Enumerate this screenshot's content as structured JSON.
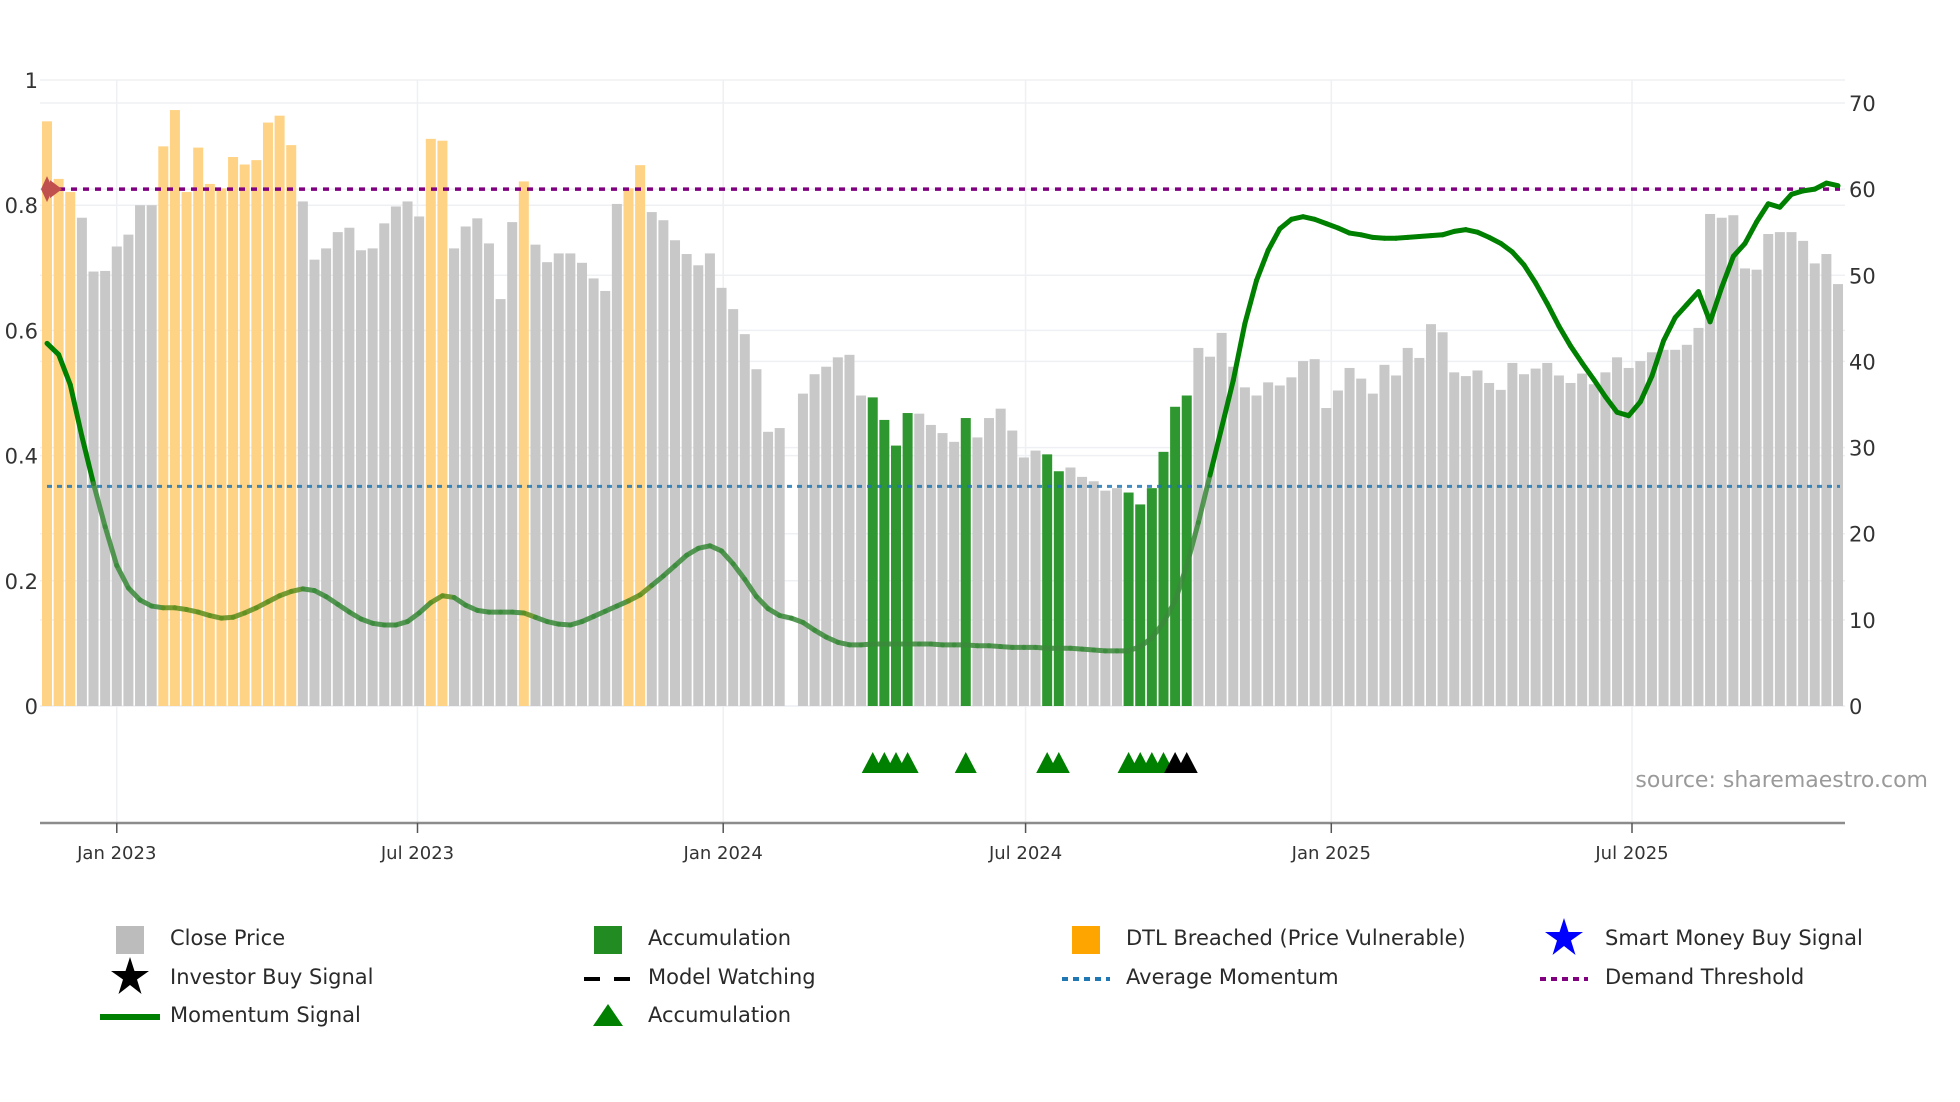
{
  "chart_data": {
    "type": "bar",
    "start_date": "2022-11-20",
    "interval_days": 7,
    "left_axis": {
      "range": [
        0,
        1
      ],
      "ticks": [
        0,
        0.2,
        0.4,
        0.6,
        0.8,
        1
      ],
      "tick_labels": [
        "0",
        "0.2",
        "0.4",
        "0.6",
        "0.8",
        "1"
      ]
    },
    "right_axis": {
      "range": [
        0,
        70
      ],
      "ticks": [
        0,
        10,
        20,
        30,
        40,
        50,
        60,
        70
      ],
      "tick_labels": [
        "0",
        "10",
        "20",
        "30",
        "40",
        "50",
        "60",
        "70"
      ]
    },
    "x_ticks": [
      {
        "date": "2023-01-01",
        "label": "Jan 2023"
      },
      {
        "date": "2023-07-01",
        "label": "Jul 2023"
      },
      {
        "date": "2024-01-01",
        "label": "Jan 2024"
      },
      {
        "date": "2024-07-01",
        "label": "Jul 2024"
      },
      {
        "date": "2025-01-01",
        "label": "Jan 2025"
      },
      {
        "date": "2025-07-01",
        "label": "Jul 2025"
      }
    ],
    "close_price": [
      0.934,
      0.842,
      0.821,
      0.78,
      0.694,
      0.695,
      0.734,
      0.753,
      0.8,
      0.8,
      0.894,
      0.952,
      0.821,
      0.892,
      0.834,
      0.827,
      0.877,
      0.865,
      0.872,
      0.932,
      0.943,
      0.896,
      0.806,
      0.713,
      0.731,
      0.757,
      0.764,
      0.728,
      0.731,
      0.771,
      0.798,
      0.806,
      0.782,
      0.906,
      0.903,
      0.731,
      0.766,
      0.779,
      0.739,
      0.65,
      0.773,
      0.838,
      0.737,
      0.709,
      0.723,
      0.723,
      0.708,
      0.683,
      0.663,
      0.802,
      0.827,
      0.864,
      0.789,
      0.776,
      0.744,
      0.722,
      0.704,
      0.723,
      0.668,
      0.634,
      0.594,
      0.538,
      0.438,
      0.444,
      0,
      0.499,
      0.53,
      0.542,
      0.557,
      0.561,
      0.496,
      0.493,
      0.457,
      0.416,
      0.468,
      0.467,
      0.449,
      0.436,
      0.422,
      0.46,
      0.429,
      0.46,
      0.475,
      0.44,
      0.397,
      0.408,
      0.402,
      0.375,
      0.381,
      0.366,
      0.359,
      0.344,
      0.348,
      0.341,
      0.322,
      0.348,
      0.406,
      0.478,
      0.496,
      0.572,
      0.558,
      0.596,
      0.542,
      0.509,
      0.496,
      0.517,
      0.512,
      0.525,
      0.551,
      0.554,
      0.476,
      0.504,
      0.54,
      0.523,
      0.499,
      0.545,
      0.528,
      0.572,
      0.556,
      0.61,
      0.597,
      0.533,
      0.527,
      0.536,
      0.516,
      0.505,
      0.548,
      0.53,
      0.539,
      0.548,
      0.528,
      0.516,
      0.531,
      0.514,
      0.533,
      0.557,
      0.54,
      0.551,
      0.565,
      0.569,
      0.569,
      0.577,
      0.604,
      0.786,
      0.78,
      0.784,
      0.699,
      0.697,
      0.754,
      0.757,
      0.757,
      0.743,
      0.707,
      0.722,
      0.674
    ],
    "dtl_breached_indices": [
      0,
      1,
      2,
      10,
      11,
      12,
      13,
      14,
      15,
      16,
      17,
      18,
      19,
      20,
      21,
      33,
      34,
      41,
      50,
      51
    ],
    "accumulation_indices": [
      71,
      72,
      73,
      74,
      79,
      86,
      87,
      93,
      94,
      95,
      96,
      97,
      98
    ],
    "momentum_signal": [
      42.1,
      40.8,
      37.3,
      31.3,
      25.8,
      20.8,
      16.3,
      13.7,
      12.3,
      11.6,
      11.4,
      11.4,
      11.2,
      10.9,
      10.5,
      10.2,
      10.3,
      10.8,
      11.4,
      12.1,
      12.8,
      13.3,
      13.6,
      13.4,
      12.7,
      11.8,
      10.9,
      10.1,
      9.6,
      9.4,
      9.4,
      9.8,
      10.8,
      12.0,
      12.8,
      12.6,
      11.7,
      11.1,
      10.9,
      10.9,
      10.9,
      10.8,
      10.3,
      9.8,
      9.5,
      9.4,
      9.8,
      10.4,
      11.0,
      11.6,
      12.2,
      12.9,
      14.0,
      15.1,
      16.3,
      17.5,
      18.3,
      18.6,
      18.0,
      16.5,
      14.7,
      12.7,
      11.3,
      10.5,
      10.2,
      9.7,
      8.8,
      8.0,
      7.4,
      7.1,
      7.1,
      7.2,
      7.2,
      7.2,
      7.2,
      7.2,
      7.2,
      7.1,
      7.1,
      7.1,
      7.0,
      7.0,
      6.9,
      6.8,
      6.8,
      6.8,
      6.7,
      6.7,
      6.7,
      6.6,
      6.5,
      6.4,
      6.4,
      6.4,
      6.9,
      7.9,
      9.7,
      12.2,
      16.3,
      21.3,
      26.8,
      32.3,
      37.8,
      44.4,
      49.4,
      52.9,
      55.4,
      56.5,
      56.8,
      56.5,
      56.0,
      55.5,
      54.9,
      54.7,
      54.4,
      54.3,
      54.3,
      54.4,
      54.5,
      54.6,
      54.7,
      55.1,
      55.3,
      55.0,
      54.4,
      53.7,
      52.7,
      51.2,
      49.1,
      46.7,
      44.1,
      41.8,
      39.8,
      37.9,
      35.9,
      34.1,
      33.7,
      35.3,
      38.3,
      42.4,
      45.1,
      46.6,
      48.1,
      44.6,
      48.6,
      52.2,
      53.7,
      56.2,
      58.3,
      57.9,
      59.4,
      59.8,
      60.0,
      60.7,
      60.4
    ],
    "average_momentum": 25.5,
    "demand_threshold": 60,
    "accumulation_marker_indices": [
      71,
      72,
      73,
      74,
      79,
      86,
      87,
      93,
      94,
      95,
      96
    ],
    "black_marker_indices": [
      97,
      98
    ],
    "colors": {
      "close_price": "#c8c8c8",
      "dtl": "#ffd385",
      "accumulation": "#2f972f",
      "momentum_high": "#008000",
      "momentum_low": "#3a8a3a",
      "momentum_dtl": "#5f8f1f",
      "average_momentum": "#1f77b4",
      "demand_threshold": "#800080",
      "marker_green": "#008000",
      "marker_black": "#000000"
    }
  },
  "source": "source: sharemaestro.com",
  "legend": {
    "close_price": "Close Price",
    "accumulation_bar": "Accumulation",
    "dtl_breached": "DTL Breached (Price Vulnerable)",
    "smart_money": "Smart Money Buy Signal",
    "investor_buy": "Investor Buy Signal",
    "model_watching": "Model Watching",
    "average_momentum": "Average Momentum",
    "demand_threshold": "Demand Threshold",
    "momentum_signal": "Momentum Signal",
    "accumulation_marker": "Accumulation"
  }
}
